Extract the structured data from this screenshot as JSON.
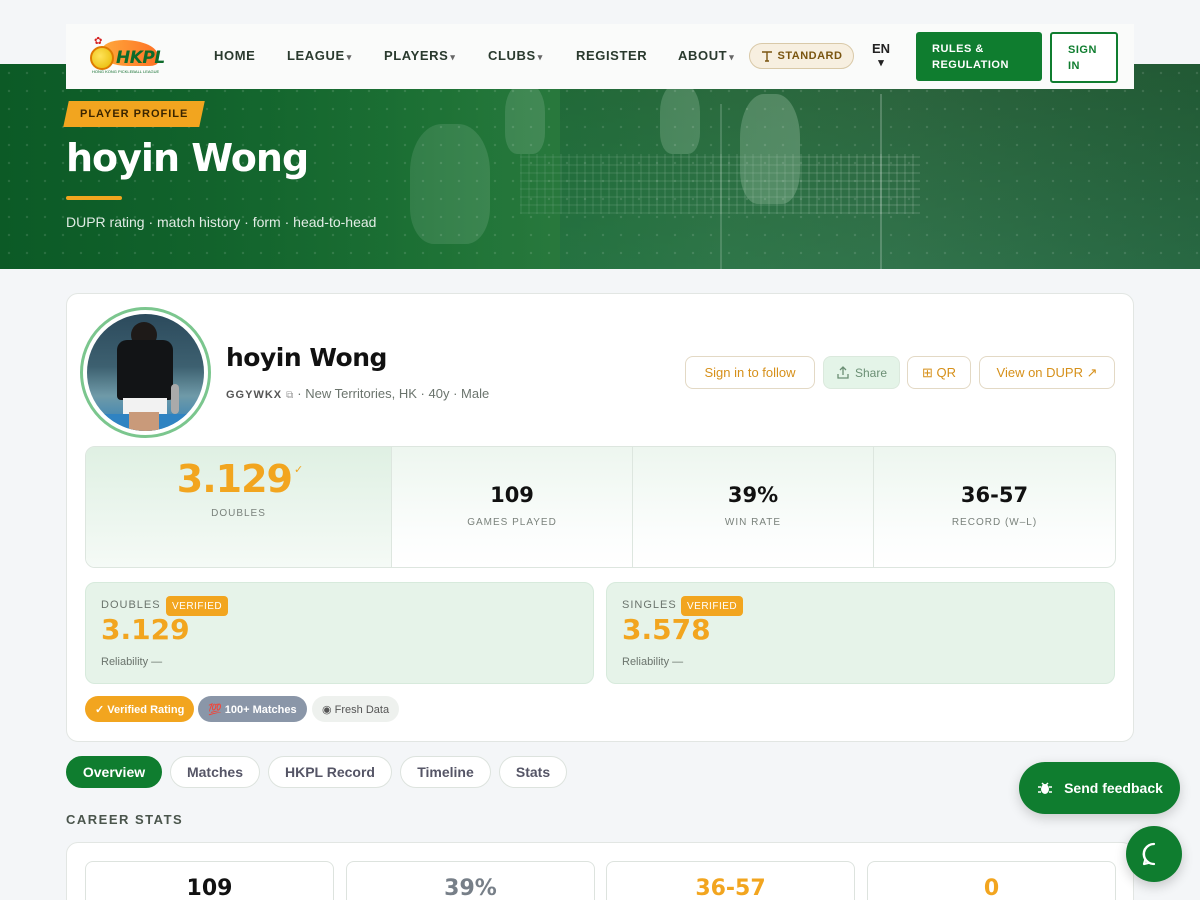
{
  "nav": {
    "logo_text": "HKPL",
    "logo_sub": "HONG KONG PICKLEBALL LEAGUE",
    "items": [
      {
        "label": "HOME",
        "caret": false
      },
      {
        "label": "LEAGUE",
        "caret": true
      },
      {
        "label": "PLAYERS",
        "caret": true
      },
      {
        "label": "CLUBS",
        "caret": true
      },
      {
        "label": "REGISTER",
        "caret": false
      },
      {
        "label": "ABOUT",
        "caret": true
      }
    ],
    "caret_glyph": "▾",
    "standard_label": "STANDARD",
    "lang": "EN",
    "lang_caret": "▾",
    "rules_label": "RULES & REGULATION",
    "signin_label": "SIGN IN"
  },
  "hero": {
    "badge": "PLAYER PROFILE",
    "title": "hoyin Wong",
    "subtitle": "DUPR rating · match history · form · head-to-head"
  },
  "profile": {
    "name": "hoyin Wong",
    "code": "GGYWKX",
    "copy_glyph": "⧉",
    "meta": "· New Territories, HK · 40y · Male",
    "actions": {
      "follow": "Sign in to follow",
      "share": "Share",
      "qr": "⊞ QR",
      "dupr": "View on DUPR ↗"
    },
    "stats": {
      "rating": "3.129",
      "rating_check": "✓",
      "rating_label": "DOUBLES",
      "games": "109",
      "games_label": "GAMES PLAYED",
      "win_rate": "39%",
      "win_rate_label": "WIN RATE",
      "record": "36-57",
      "record_label": "RECORD (W–L)"
    },
    "doubles": {
      "label": "DOUBLES",
      "verified": "VERIFIED",
      "value": "3.129",
      "reliability": "Reliability —"
    },
    "singles": {
      "label": "SINGLES",
      "verified": "VERIFIED",
      "value": "3.578",
      "reliability": "Reliability —"
    },
    "chips": [
      "✓ Verified Rating",
      "💯 100+ Matches",
      "◉ Fresh Data"
    ]
  },
  "tabs": [
    "Overview",
    "Matches",
    "HKPL Record",
    "Timeline",
    "Stats"
  ],
  "career": {
    "title": "CAREER STATS",
    "values": [
      "109",
      "39%",
      "36-57",
      "0"
    ],
    "colors": [
      "#111111",
      "#777f88",
      "#f2a51f",
      "#f2a51f"
    ]
  },
  "floating": {
    "feedback": "Send feedback"
  },
  "colors": {
    "primary": "#0f7d2f",
    "accent": "#f2a51f"
  }
}
